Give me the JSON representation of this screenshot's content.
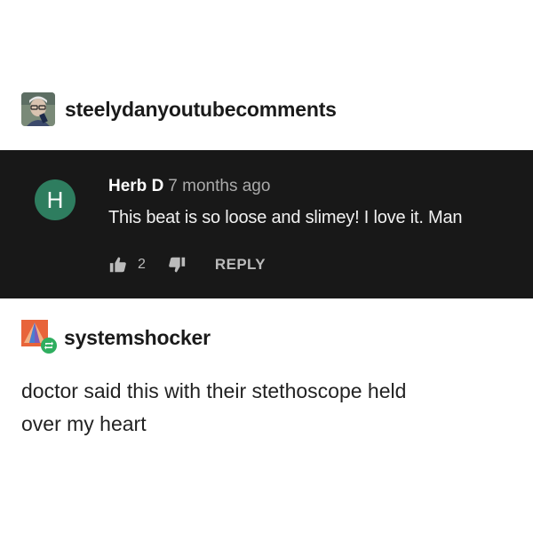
{
  "post1": {
    "blog_name": "steelydanyoutubecomments",
    "avatar_icon": "person-with-glasses-avatar"
  },
  "comment": {
    "avatar_letter": "H",
    "avatar_color": "#2e7d5f",
    "author": "Herb D",
    "time": "7 months ago",
    "text": "This beat is so loose and slimey! I love it. Man",
    "like_icon": "thumbs-up-icon",
    "like_count": "2",
    "dislike_icon": "thumbs-down-icon",
    "reply_label": "REPLY",
    "background": "#181818"
  },
  "post2": {
    "blog_name": "systemshocker",
    "avatar_icon": "orange-geometric-avatar",
    "reblog_icon": "reblog-icon",
    "body_line1": "doctor said this with their stethoscope held",
    "body_line2": "over my heart"
  }
}
